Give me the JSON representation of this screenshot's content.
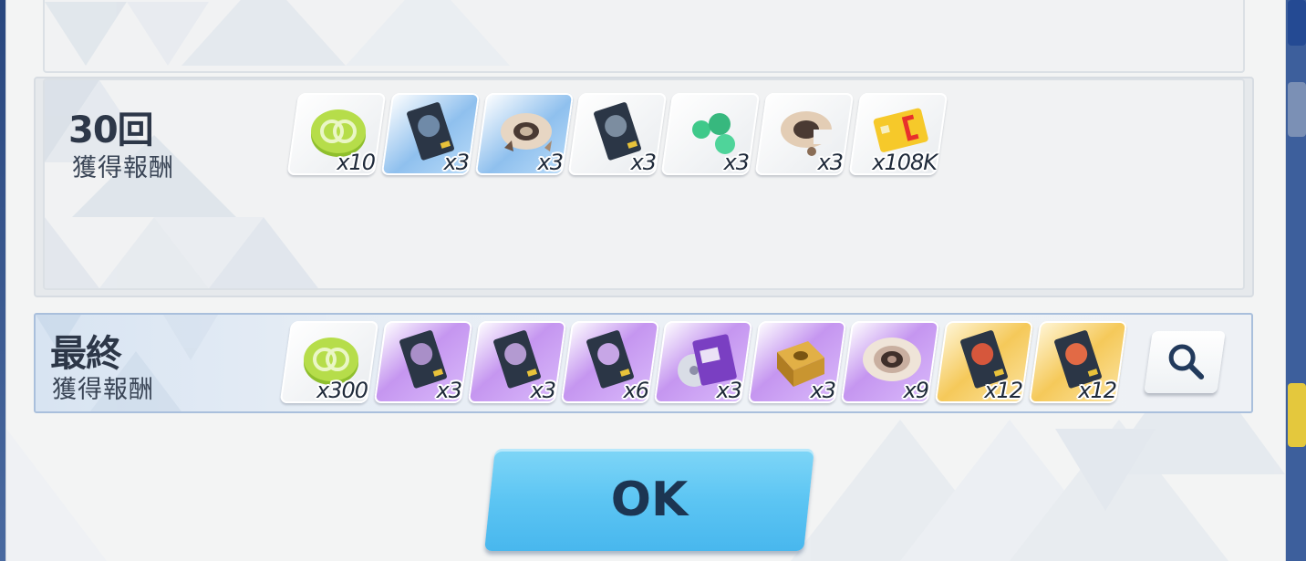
{
  "rewards_30": {
    "count_label": "30回",
    "sub_label": "獲得報酬",
    "items": [
      {
        "icon": "green-coin-icon",
        "quantity": "x10",
        "rarity": "white"
      },
      {
        "icon": "blue-tech-notes-icon",
        "quantity": "x3",
        "rarity": "blue"
      },
      {
        "icon": "gear-part-icon",
        "quantity": "x3",
        "rarity": "blue"
      },
      {
        "icon": "tech-notes-icon",
        "quantity": "x3",
        "rarity": "white"
      },
      {
        "icon": "green-orbs-icon",
        "quantity": "x3",
        "rarity": "white"
      },
      {
        "icon": "gear-part-icon",
        "quantity": "x3",
        "rarity": "white"
      },
      {
        "icon": "credit-card-icon",
        "quantity": "x108K",
        "rarity": "white"
      }
    ]
  },
  "rewards_final": {
    "count_label": "最終",
    "sub_label": "獲得報酬",
    "items": [
      {
        "icon": "green-coin-icon",
        "quantity": "x300",
        "rarity": "white"
      },
      {
        "icon": "purple-tech-notes-icon",
        "quantity": "x3",
        "rarity": "purple"
      },
      {
        "icon": "purple-tech-notes-icon",
        "quantity": "x3",
        "rarity": "purple"
      },
      {
        "icon": "purple-tech-notes-icon",
        "quantity": "x6",
        "rarity": "purple"
      },
      {
        "icon": "ex-disc-icon",
        "quantity": "x3",
        "rarity": "purple"
      },
      {
        "icon": "gold-box-icon",
        "quantity": "x3",
        "rarity": "purple"
      },
      {
        "icon": "gear-part-icon",
        "quantity": "x9",
        "rarity": "purple"
      },
      {
        "icon": "gold-tech-notes-icon",
        "quantity": "x12",
        "rarity": "gold"
      },
      {
        "icon": "gold-tech-notes-icon",
        "quantity": "x12",
        "rarity": "gold"
      }
    ]
  },
  "buttons": {
    "ok_label": "OK",
    "search_icon": "search-icon"
  },
  "colors": {
    "ok_button": "#5cc5f3",
    "panel": "#f1f2f3",
    "final_border": "#a9bfdc"
  }
}
